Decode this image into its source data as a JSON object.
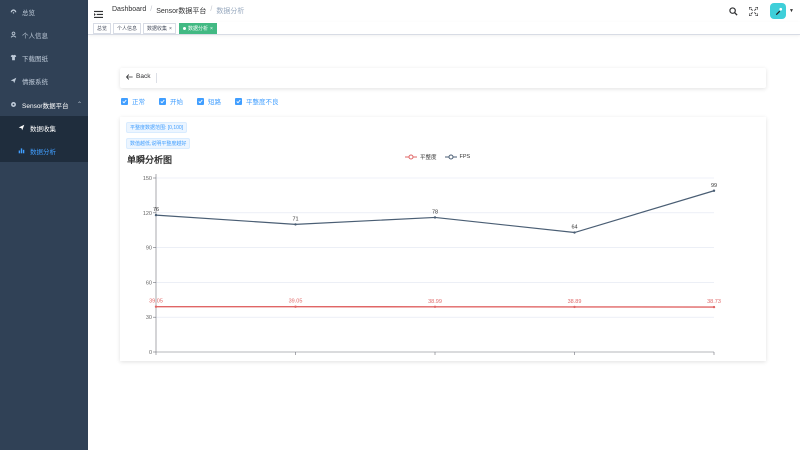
{
  "sidebar": {
    "items": [
      {
        "label": "总览",
        "icon": "dashboard-icon"
      },
      {
        "label": "个人信息",
        "icon": "user-icon"
      },
      {
        "label": "下载图纸",
        "icon": "shirt-icon"
      },
      {
        "label": "情报系统",
        "icon": "send-icon"
      },
      {
        "label": "Sensor数据平台",
        "icon": "gear-icon"
      },
      {
        "label": "数据收集",
        "icon": "send-icon"
      },
      {
        "label": "数据分析",
        "icon": "bar-chart-icon"
      }
    ]
  },
  "navbar": {
    "breadcrumb": [
      "Dashboard",
      "Sensor数据平台",
      "数据分析"
    ]
  },
  "tags": [
    {
      "label": "总览"
    },
    {
      "label": "个人信息"
    },
    {
      "label": "数据收集"
    },
    {
      "label": "数据分析"
    }
  ],
  "back": {
    "label": "Back"
  },
  "filters": [
    "正常",
    "开始",
    "短路",
    "平整度不良"
  ],
  "info_tags": [
    "平整度数据范围: [0,100]",
    "数值越低,说明平整度越好"
  ],
  "chart_data": {
    "type": "line",
    "title": "单瞬分析图",
    "categories": [
      "",
      "",
      "",
      "",
      ""
    ],
    "series": [
      {
        "name": "平整度",
        "color": "#e06666",
        "values": [
          39.05,
          39.05,
          38.99,
          38.89,
          38.73
        ],
        "labels": [
          "39.05",
          "39.05",
          "38.99",
          "38.89",
          "38.73"
        ]
      },
      {
        "name": "FPS",
        "color": "#4a5e74",
        "values": [
          118,
          110,
          116,
          103,
          139
        ],
        "labels": [
          "76",
          "71",
          "78",
          "64",
          "99"
        ]
      }
    ],
    "yticks": [
      "0",
      "30",
      "60",
      "90",
      "120",
      "150"
    ],
    "ylim": [
      0,
      150
    ],
    "grid": true,
    "legend_position": "top-center"
  },
  "colors": {
    "accent": "#409eff",
    "sidebar": "#304156",
    "active_tag": "#42b983"
  }
}
